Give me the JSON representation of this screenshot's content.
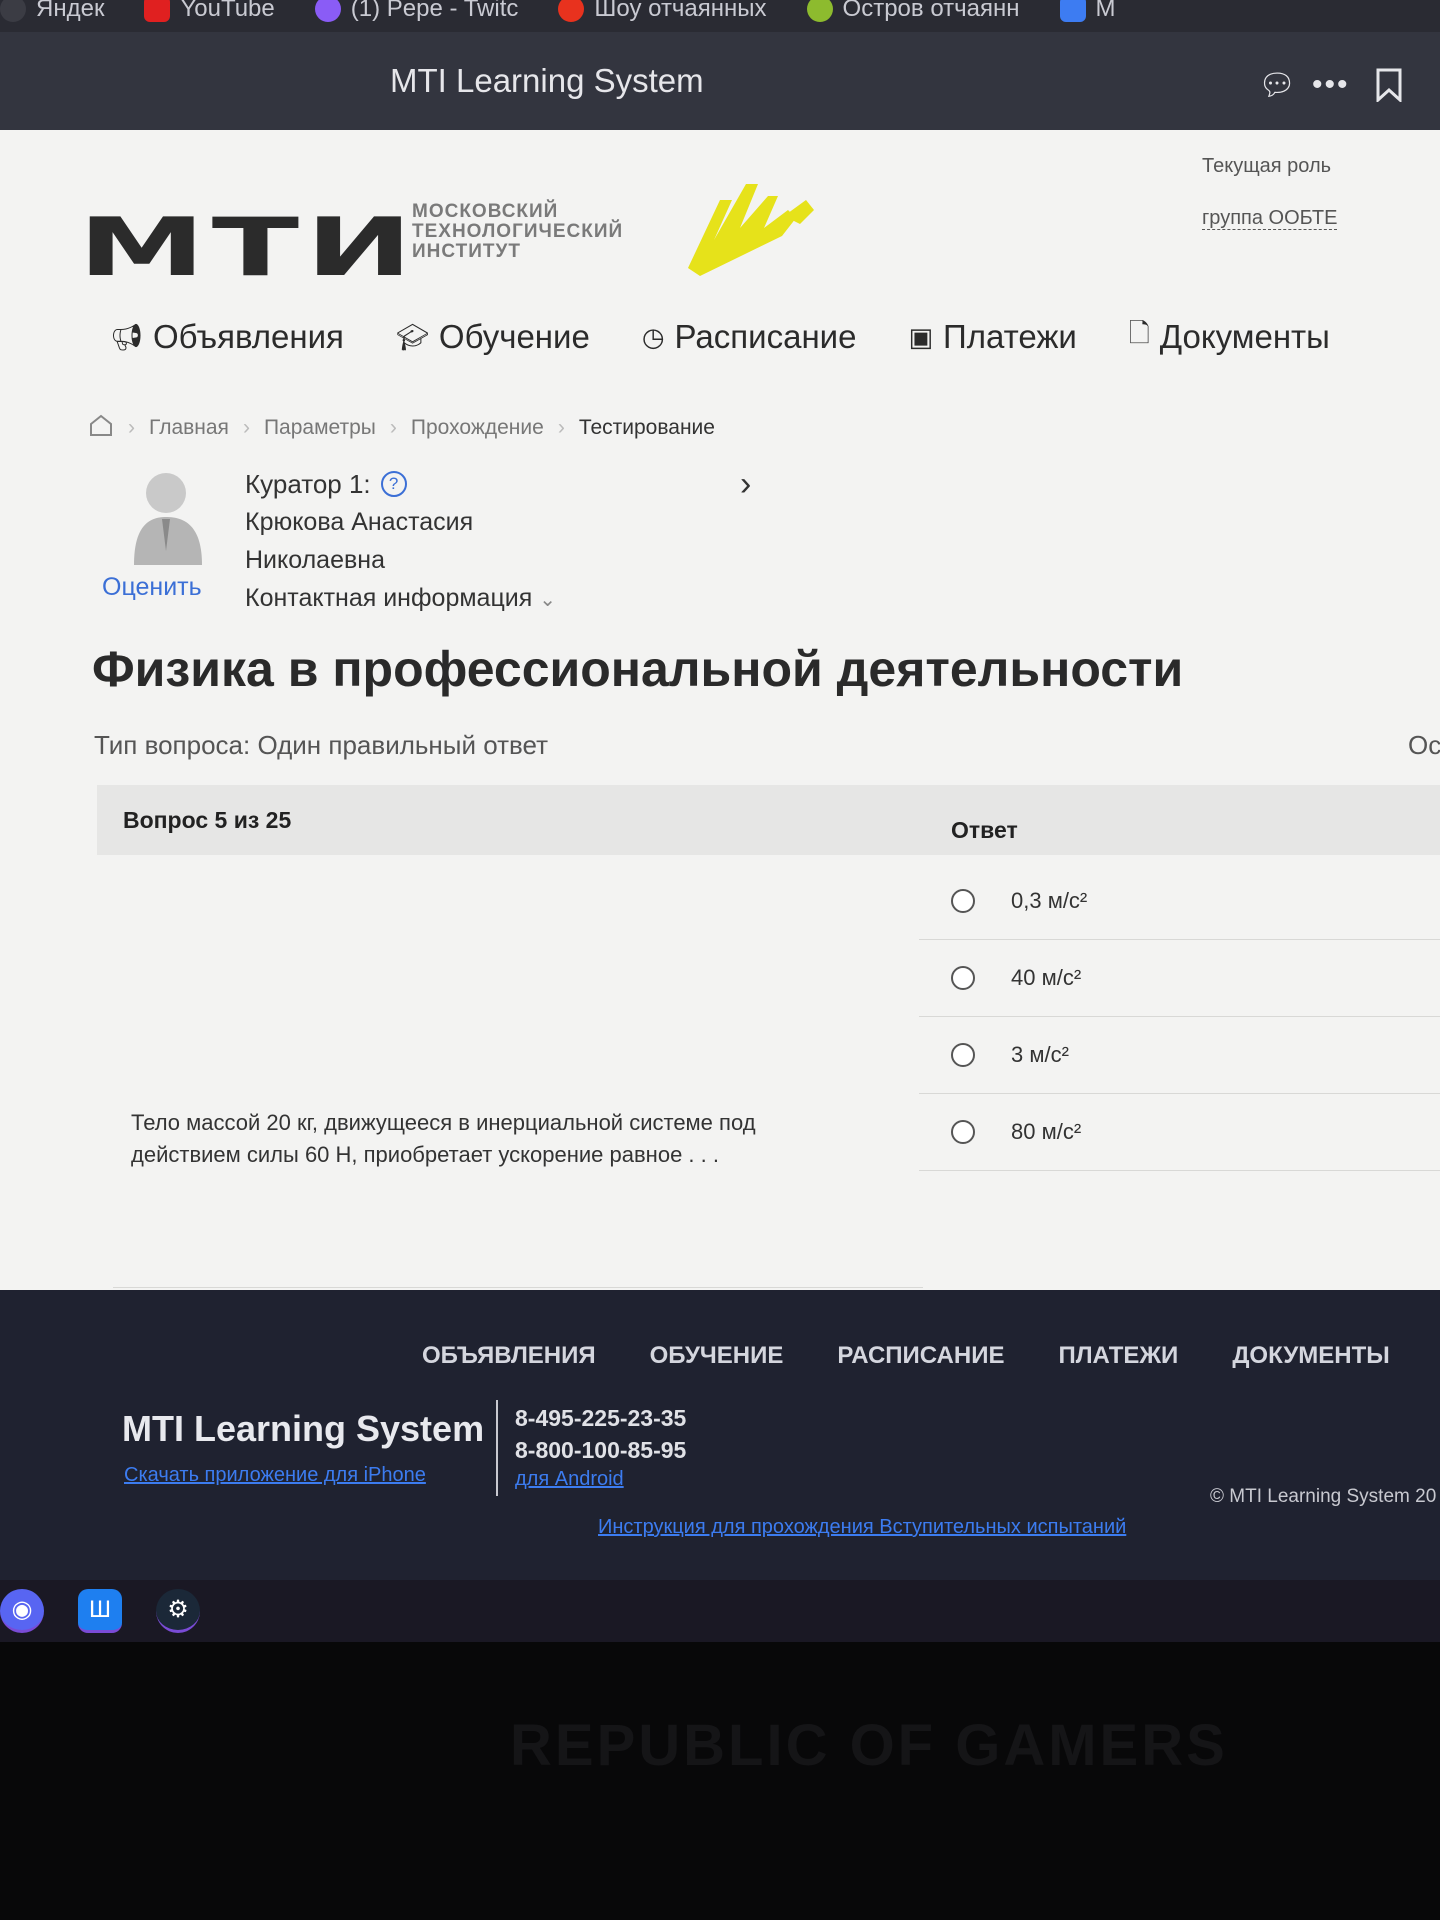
{
  "browser": {
    "tabs": [
      "Яндек",
      "YouTube",
      "(1) Pepe - Twitc",
      "Шоу отчаянных",
      "Остров отчаянн",
      "М"
    ],
    "title": "MTI Learning System"
  },
  "logo": {
    "abbr": "МТИ",
    "line1": "МОСКОВСКИЙ",
    "line2": "ТЕХНОЛОГИЧЕСКИЙ",
    "line3": "ИНСТИТУТ"
  },
  "nav": [
    {
      "label": "Объявления",
      "icon": "megaphone-icon"
    },
    {
      "label": "Обучение",
      "icon": "graduation-cap-icon"
    },
    {
      "label": "Расписание",
      "icon": "clock-icon"
    },
    {
      "label": "Платежи",
      "icon": "wallet-icon"
    },
    {
      "label": "Документы",
      "icon": "document-icon"
    }
  ],
  "breadcrumb": [
    "Главная",
    "Параметры",
    "Прохождение",
    "Тестирование"
  ],
  "curator": {
    "title": "Куратор 1:",
    "name_line1": "Крюкова Анастасия",
    "name_line2": "Николаевна",
    "contact": "Контактная информация",
    "rate": "Оценить"
  },
  "role": {
    "label": "Текущая роль",
    "group": "группа ООБТЕ"
  },
  "course_title": "Физика в профессиональной деятельности",
  "question_type": "Тип вопроса: Один правильный ответ",
  "question_type_right": "Ос",
  "table": {
    "question_header": "Вопрос 5 из 25",
    "answer_header": "Ответ",
    "question_text": "Тело массой 20 кг, движущееся в инерциальной системе под действием силы 60 Н, приобретает ускорение равное . . .",
    "answers": [
      "0,3 м/с²",
      "40 м/с²",
      "3 м/с²",
      "80 м/с²"
    ]
  },
  "footer": {
    "nav": [
      "ОБЪЯВЛЕНИЯ",
      "ОБУЧЕНИЕ",
      "РАСПИСАНИЕ",
      "ПЛАТЕЖИ",
      "ДОКУМЕНТЫ"
    ],
    "brand": "MTI Learning System",
    "iphone_link": "Скачать приложение для iPhone",
    "phone1": "8-495-225-23-35",
    "phone2": "8-800-100-85-95",
    "android_link": "для Android",
    "copyright": "© MTI Learning System 20",
    "instructions_link": "Инструкция для прохождения Вступительных испытаний"
  },
  "taskbar": [
    "discord-icon",
    "app-icon",
    "steam-icon"
  ],
  "bezel_text": "REPUBLIC OF GAMERS",
  "colors": {
    "accent": "#3b6fd6",
    "logo_yellow": "#e6e21a",
    "footer_bg": "#1f2230",
    "link": "#3c7cf0"
  }
}
